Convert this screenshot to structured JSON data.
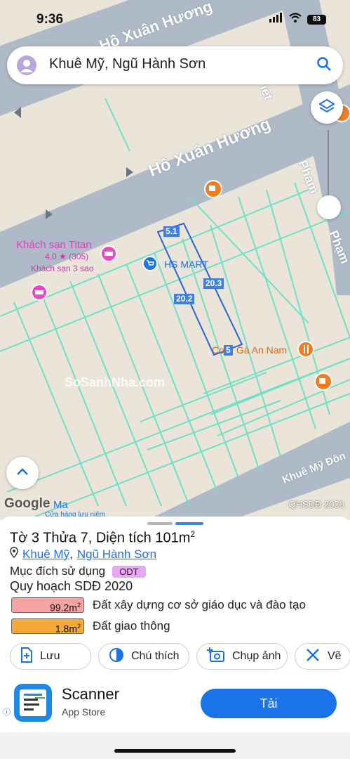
{
  "status_bar": {
    "time": "9:36",
    "battery": "83"
  },
  "search": {
    "query": "Khuê Mỹ, Ngũ Hành Sơn"
  },
  "map": {
    "streets": {
      "top": "Hồ Xuân Hương",
      "main": "Hồ Xuân Hương",
      "right_vertical": "Phạm",
      "right_vertical_2": "Phạm",
      "top_right": "iệt",
      "bottom": "Khuê Mỹ Đôn"
    },
    "pois": {
      "hotel_name": "Khách sạn Titan",
      "hotel_rating": "4.0 ★ (305)",
      "hotel_type": "Khách sạn 3 sao",
      "mart": "HS MART",
      "restaurant": "Cơm Gà An Nam",
      "bottom_left": "Ma",
      "bottom_left_sub": "Cửa hàng lưu niệm"
    },
    "dimensions": {
      "top": "5.1",
      "left": "20.2",
      "right": "20.3",
      "bottom": "5"
    },
    "watermark": "SoSanhNha.com",
    "google": "Google",
    "layer_tag": "QHSDĐ 2020"
  },
  "sheet": {
    "title": "Tờ 3 Thửa 7, Diện tích 101m",
    "title_sup": "2",
    "location_1": "Khuê Mỹ",
    "location_sep": ",",
    "location_2": "Ngũ Hành Sơn",
    "purpose_label": "Mục đích sử dụng",
    "purpose_badge": "ODT",
    "plan_title": "Quy hoạch SDĐ 2020",
    "legend": [
      {
        "value": "99.2m",
        "sup": "2",
        "color": "#f5a3a3",
        "desc": "Đất xây dựng cơ sở giáo dục và đào tạo"
      },
      {
        "value": "1.8m",
        "sup": "2",
        "color": "#f6a93a",
        "desc": "Đất giao thông"
      }
    ],
    "actions": {
      "save": "Lưu",
      "legend": "Chú thích",
      "photo": "Chụp ảnh",
      "draw": "Vẽ"
    }
  },
  "ad": {
    "app_name": "Scanner",
    "store": "App Store",
    "install": "Tải"
  },
  "colors": {
    "road": "#aebac7",
    "land": "#ebe5d9",
    "parcel": "#6fe0c8",
    "accent": "#1a73e8"
  }
}
